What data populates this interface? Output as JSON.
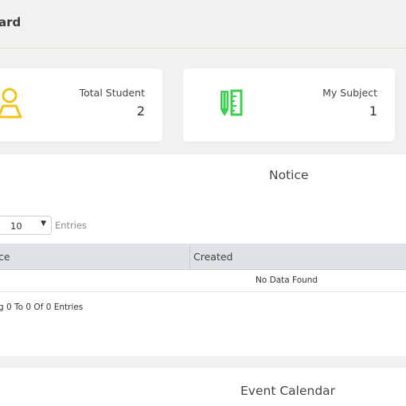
{
  "header": {
    "title": "ard"
  },
  "stats": {
    "total_student": {
      "label": "Total Student",
      "value": "2",
      "icon": "student-icon",
      "color": "#f2c21b"
    },
    "my_subject": {
      "label": "My Subject",
      "value": "1",
      "icon": "ruler-pencil-icon",
      "color": "#3ccf4e"
    }
  },
  "notice": {
    "title": "Notice",
    "entries_select": {
      "value": "10",
      "options": [
        "10"
      ]
    },
    "entries_label": "Entries",
    "table": {
      "columns": [
        "ce",
        "Created"
      ],
      "empty_text": "No Data Found"
    },
    "showing": "g 0 To 0 Of 0 Entries"
  },
  "event_calendar": {
    "title": "Event Calendar"
  },
  "colors": {
    "background": "#f3f1ef",
    "card": "#ffffff",
    "table_header": "#dfe3e5"
  }
}
